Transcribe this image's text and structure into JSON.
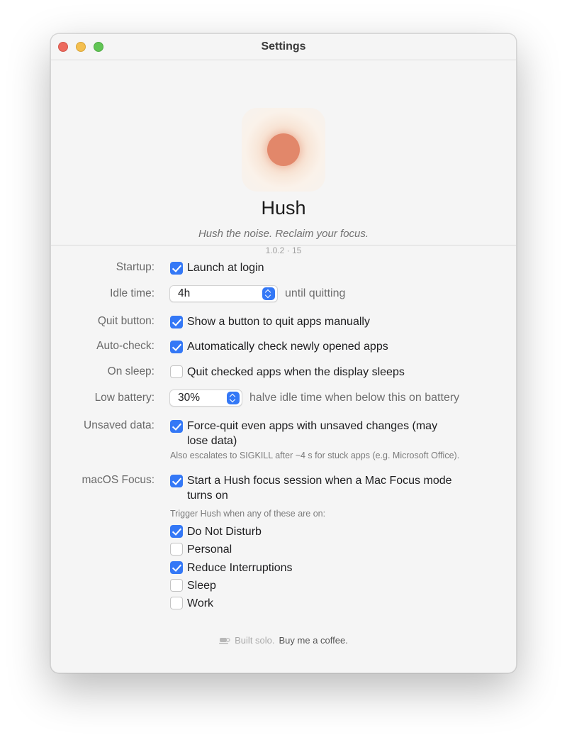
{
  "window": {
    "title": "Settings"
  },
  "hero": {
    "app_name": "Hush",
    "tagline": "Hush the noise. Reclaim your focus.",
    "version": "1.0.2 · 15",
    "accent_color": "#e2876a"
  },
  "settings": {
    "startup": {
      "label": "Startup:",
      "option": "Launch at login",
      "checked": true
    },
    "idle_time": {
      "label": "Idle time:",
      "value": "4h",
      "suffix": "until quitting"
    },
    "quit_button": {
      "label": "Quit button:",
      "option": "Show a button to quit apps manually",
      "checked": true
    },
    "auto_check": {
      "label": "Auto-check:",
      "option": "Automatically check newly opened apps",
      "checked": true
    },
    "on_sleep": {
      "label": "On sleep:",
      "option": "Quit checked apps when the display sleeps",
      "checked": false
    },
    "low_battery": {
      "label": "Low battery:",
      "value": "30%",
      "suffix": "halve idle time when below this on battery"
    },
    "unsaved_data": {
      "label": "Unsaved data:",
      "option_line1": "Force-quit even apps with unsaved changes (may",
      "option_line2": "lose data)",
      "checked": true,
      "note": "Also escalates to SIGKILL after ~4 s for stuck apps (e.g. Microsoft Office)."
    },
    "macos_focus": {
      "label": "macOS Focus:",
      "option_line1": "Start a Hush focus session when a Mac Focus mode",
      "option_line2": "turns on",
      "checked": true,
      "trigger_note": "Trigger Hush when any of these are on:",
      "modes": [
        {
          "label": "Do Not Disturb",
          "checked": true
        },
        {
          "label": "Personal",
          "checked": false
        },
        {
          "label": "Reduce Interruptions",
          "checked": true
        },
        {
          "label": "Sleep",
          "checked": false
        },
        {
          "label": "Work",
          "checked": false
        }
      ]
    }
  },
  "footer": {
    "built": "Built solo.",
    "coffee": "Buy me a coffee.",
    "icon": "coffee-cup-icon"
  },
  "colors": {
    "checkbox_checked": "#3478f6",
    "window_bg": "#f5f5f5"
  }
}
